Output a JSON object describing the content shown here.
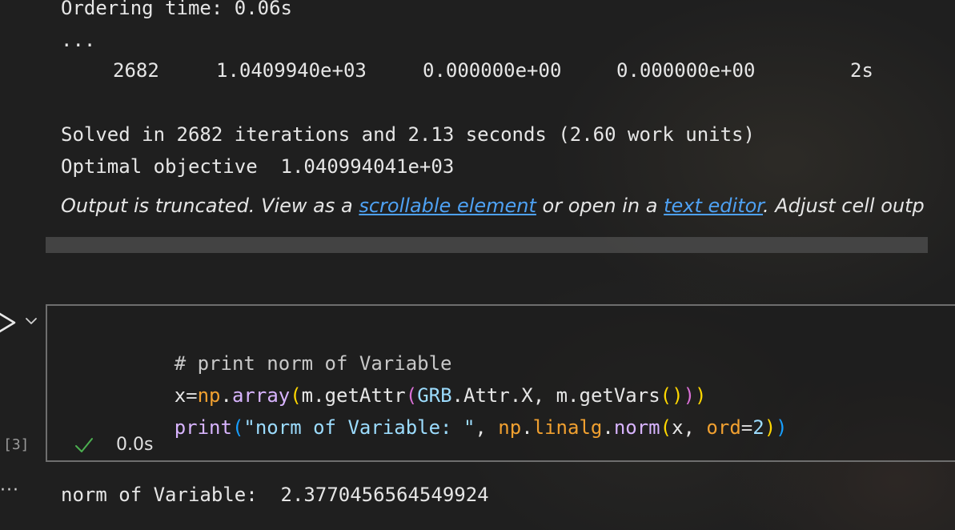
{
  "output_log": {
    "line_ordering": "Ordering time: 0.06s",
    "line_ellipsis": "...",
    "iter_row": {
      "iter": "2682",
      "primal": "1.0409940e+03",
      "dual": "0.000000e+00",
      "infeas": "0.000000e+00",
      "time": "2s"
    },
    "line_solved": "Solved in 2682 iterations and 2.13 seconds (2.60 work units)",
    "line_optimal": "Optimal objective  1.040994041e+03"
  },
  "truncation_notice": {
    "prefix": "Output is truncated. View as a ",
    "link_scrollable": "scrollable element",
    "middle": " or open in a ",
    "link_text_editor": "text editor",
    "suffix": ". Adjust cell outp"
  },
  "cell": {
    "execution_count": "[3]",
    "exec_time": "0.0s",
    "code_lines": [
      "# print norm of Variable",
      "x=np.array(m.getAttr(GRB.Attr.X, m.getVars()))",
      "print(\"norm of Variable: \", np.linalg.norm(x, ord=2))"
    ],
    "tokens": {
      "l1": "# print norm of Variable",
      "l2_x": "x",
      "l2_eq": "=",
      "l2_np": "np",
      "l2_dot1": ".",
      "l2_array": "array",
      "l2_p1": "(",
      "l2_m": "m",
      "l2_dot2": ".",
      "l2_getattr": "getAttr",
      "l2_p2": "(",
      "l2_grb": "GRB",
      "l2_rest1": ".Attr.X, ",
      "l2_m2": "m",
      "l2_dot3": ".",
      "l2_getvars": "getVars",
      "l2_p3": "()",
      "l2_p4": ")",
      "l2_p5": ")",
      "l3_print": "print",
      "l3_p1": "(",
      "l3_str": "\"norm of Variable: \"",
      "l3_comma": ", ",
      "l3_np": "np",
      "l3_dot1": ".",
      "l3_linalg": "linalg",
      "l3_dot2": ".",
      "l3_norm": "norm",
      "l3_p2": "(",
      "l3_x": "x",
      "l3_comma2": ", ",
      "l3_ord": "ord",
      "l3_eq": "=",
      "l3_two": "2",
      "l3_p3": ")",
      "l3_p4": ")"
    }
  },
  "cell_output": {
    "ellipsis": "···",
    "text": "norm of Variable:  2.3770456564549924"
  },
  "icons": {
    "run": "run-icon",
    "collapse": "chevron-down-icon",
    "success": "check-icon"
  },
  "colors": {
    "background": "#1f1f1f",
    "link": "#4ea1f3",
    "success": "#4caf50",
    "cell_border": "#6e6e6e"
  }
}
